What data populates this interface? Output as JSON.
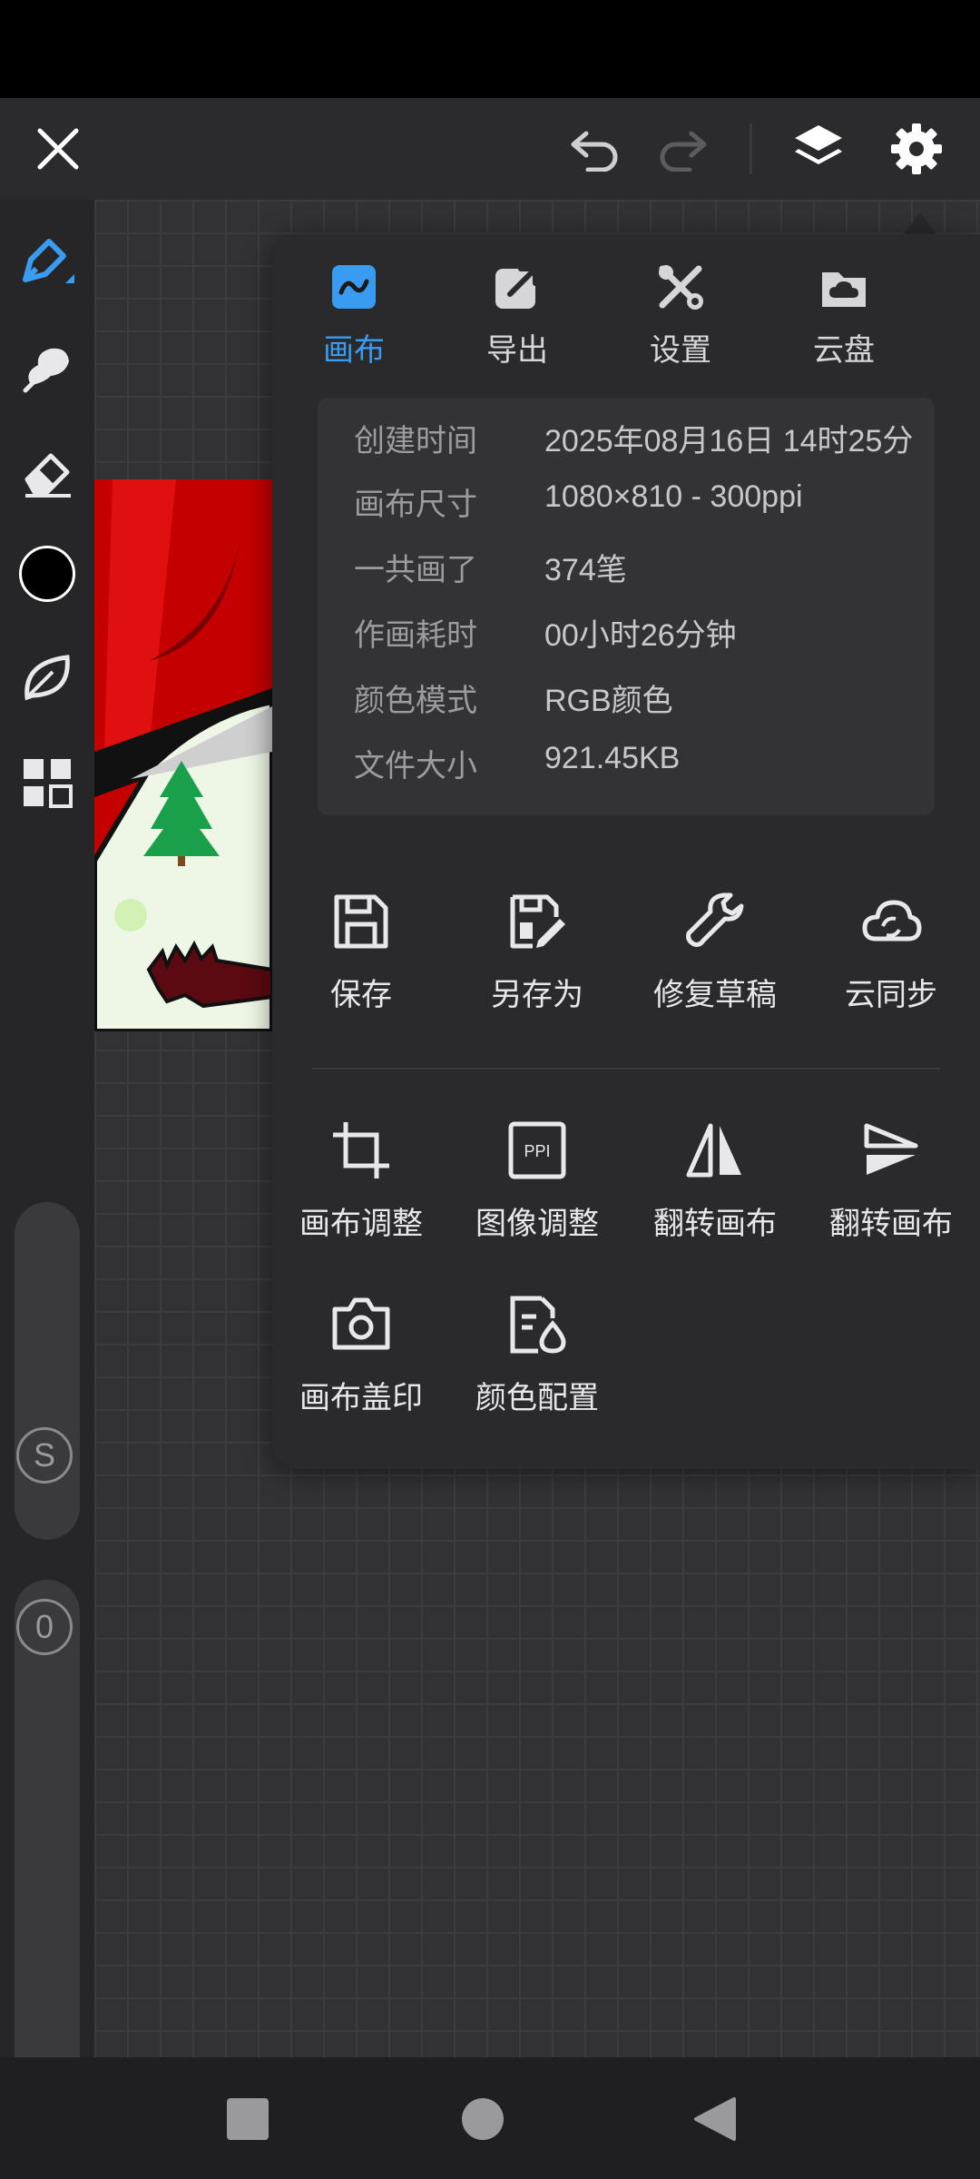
{
  "topbar": {
    "close_icon": "close-icon",
    "undo_icon": "undo-icon",
    "redo_icon": "redo-icon",
    "layers_icon": "layers-icon",
    "settings_icon": "gear-icon"
  },
  "toolbar": {
    "tools": [
      "pen-tool-icon",
      "smudge-tool-icon",
      "eraser-tool-icon",
      "color-swatch",
      "leaf-brush-icon",
      "grid-menu-icon"
    ],
    "current_color": "#000000",
    "size_badge": "S",
    "opacity_badge": "0"
  },
  "panel": {
    "tabs": [
      {
        "label": "画布",
        "icon": "canvas-icon",
        "active": true
      },
      {
        "label": "导出",
        "icon": "export-icon",
        "active": false
      },
      {
        "label": "设置",
        "icon": "tools-icon",
        "active": false
      },
      {
        "label": "云盘",
        "icon": "cloud-drive-icon",
        "active": false
      }
    ],
    "info": [
      {
        "key": "创建时间",
        "value": "2025年08月16日 14时25分"
      },
      {
        "key": "画布尺寸",
        "value": "1080×810 - 300ppi"
      },
      {
        "key": "一共画了",
        "value": "374笔"
      },
      {
        "key": "作画耗时",
        "value": "00小时26分钟"
      },
      {
        "key": "颜色模式",
        "value": "RGB颜色"
      },
      {
        "key": "文件大小",
        "value": "921.45KB"
      }
    ],
    "file_actions": [
      {
        "label": "保存",
        "icon": "save-icon"
      },
      {
        "label": "另存为",
        "icon": "save-as-icon"
      },
      {
        "label": "修复草稿",
        "icon": "wrench-icon"
      },
      {
        "label": "云同步",
        "icon": "cloud-sync-icon"
      }
    ],
    "canvas_actions": [
      {
        "label": "画布调整",
        "icon": "crop-icon"
      },
      {
        "label": "图像调整",
        "icon": "ppi-icon"
      },
      {
        "label": "翻转画布",
        "icon": "flip-horizontal-icon"
      },
      {
        "label": "翻转画布",
        "icon": "flip-vertical-icon"
      },
      {
        "label": "画布盖印",
        "icon": "camera-icon"
      },
      {
        "label": "颜色配置",
        "icon": "color-profile-icon"
      }
    ]
  },
  "colors": {
    "accent": "#3a9cf0",
    "panel": "#2a2a2c",
    "canvas_red": "#c40000"
  },
  "navbar": {
    "recents_icon": "square-recents-icon",
    "home_icon": "circle-home-icon",
    "back_icon": "triangle-back-icon"
  }
}
